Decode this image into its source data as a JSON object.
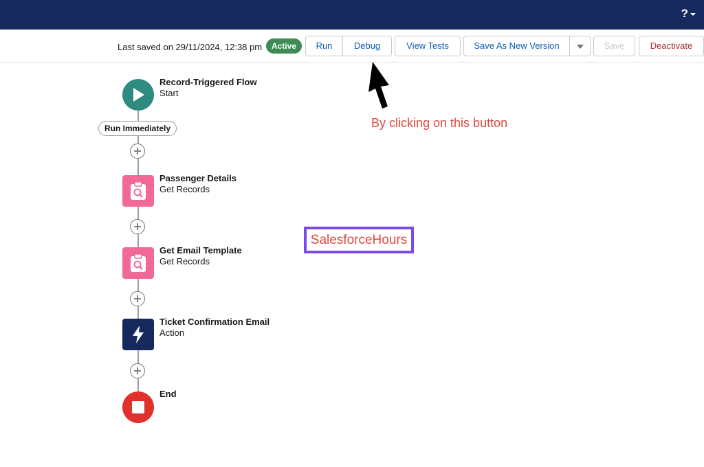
{
  "topbar": {
    "help_label": "?"
  },
  "toolbar": {
    "last_saved": "Last saved on 29/11/2024, 12:38 pm",
    "status_badge": "Active",
    "run": "Run",
    "debug": "Debug",
    "view_tests": "View Tests",
    "save_as_new_version": "Save As New Version",
    "save": "Save",
    "deactivate": "Deactivate"
  },
  "flow": {
    "start": {
      "title": "Record-Triggered Flow",
      "subtitle": "Start"
    },
    "run_pill": "Run Immediately",
    "nodes": [
      {
        "title": "Passenger Details",
        "subtitle": "Get Records",
        "icon": "get-records-icon"
      },
      {
        "title": "Get Email Template",
        "subtitle": "Get Records",
        "icon": "get-records-icon"
      },
      {
        "title": "Ticket Confirmation Email",
        "subtitle": "Action",
        "icon": "lightning-icon"
      }
    ],
    "end": {
      "title": "End"
    }
  },
  "annotation": {
    "text": "By clicking on this button"
  },
  "watermark": {
    "text": "SalesforceHours"
  },
  "colors": {
    "topbar": "#15295c",
    "active_badge": "#3e8b55",
    "start_node": "#2e8b80",
    "get_records_node": "#f06a95",
    "action_node": "#15295c",
    "end_node": "#e0312d",
    "annotation": "#e0473b",
    "watermark_border": "#7a4be8"
  }
}
